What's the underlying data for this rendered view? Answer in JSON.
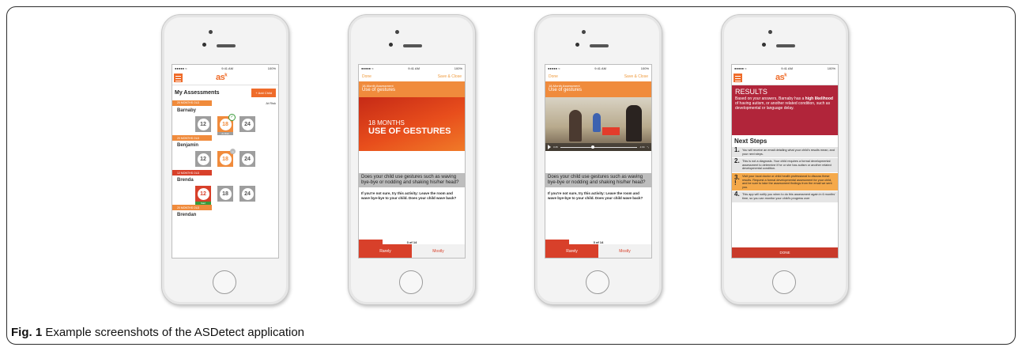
{
  "caption": {
    "label": "Fig. 1",
    "text": " Example screenshots of the ASDetect application"
  },
  "status": {
    "carrier": "●●●●● ≈",
    "time": "9:41 AM",
    "battery": "100%"
  },
  "app": {
    "logo": "as",
    "logo_mark": "k"
  },
  "screen1": {
    "title": "My Assessments",
    "add_child": "+ Add Child",
    "groups": [
      {
        "age": "20 MONTHS OLD",
        "risk": "At Risk",
        "name": "Barnaby",
        "tiles": [
          {
            "num": "12"
          },
          {
            "num": "18",
            "sub": "At Risk"
          },
          {
            "num": "24"
          }
        ]
      },
      {
        "age": "20 MONTHS OLD",
        "name": "Benjamin",
        "tiles": [
          {
            "num": "12"
          },
          {
            "num": "18"
          },
          {
            "num": "24"
          }
        ]
      },
      {
        "age": "12 MONTHS OLD",
        "name": "Brenda",
        "tiles": [
          {
            "num": "12",
            "sub": "Start"
          },
          {
            "num": "18"
          },
          {
            "num": "24"
          }
        ]
      },
      {
        "age": "20 MONTHS OLD",
        "name": "Brendan"
      }
    ]
  },
  "screen2": {
    "done": "Done",
    "save": "Save & Close",
    "assessment": "18-Month Assessment",
    "topic": "Use of gestures",
    "hero_line1": "18 MONTHS",
    "hero_line2": "USE OF GESTURES",
    "question": "Does your child use gestures such as waving bye-bye or nodding and shaking his/her head?",
    "hint": "If you're not sure, try this activity: Leave the room and wave bye-bye to your child. Does your child wave back?",
    "progress": "3 of 14",
    "rarely": "Rarely",
    "mostly": "Mostly"
  },
  "screen3": {
    "done": "Done",
    "save": "Save & Close",
    "assessment": "18-Month Assessment",
    "topic": "Use of gestures",
    "video_elapsed": "0:45",
    "video_remaining": "-1:04",
    "question": "Does your child use gestures such as waving bye-bye or nodding and shaking his/her head?",
    "hint": "If you're not sure, try this activity: Leave the room and wave bye-bye to your child. Does your child wave back?",
    "progress": "3 of 14",
    "rarely": "Rarely",
    "mostly": "Mostly"
  },
  "screen4": {
    "results_title": "RESULTS",
    "results_text_a": "Based on your answers, Barnaby has a ",
    "results_text_bold": "high likelihood",
    "results_text_b": " of having autism, or another related condition, such as developmental or language delay.",
    "next_steps": "Next Steps",
    "steps": [
      {
        "n": "1.",
        "text": "You will receive an email detailing what your child's results mean, and your next steps."
      },
      {
        "n": "2.",
        "text": "This is not a diagnosis. Your child requires a formal developmental assessment to determine if he or she has autism or another related developmental condition."
      },
      {
        "n": "3.",
        "mark": "!",
        "text": "Visit your local doctor or child health professional to discuss these results. Request a formal developmental assessment for your child, and be sure to take the assessment findings from the email we sent you."
      },
      {
        "n": "4.",
        "text": "This app will notify you when to do this assessment again in 6 months' time, so you can monitor your child's progress over"
      }
    ],
    "done": "DONE"
  },
  "colors": {
    "accent": "#ef6c2a",
    "red": "#d8402a",
    "results": "#b1253a",
    "step_highlight": "#f5a94a"
  }
}
